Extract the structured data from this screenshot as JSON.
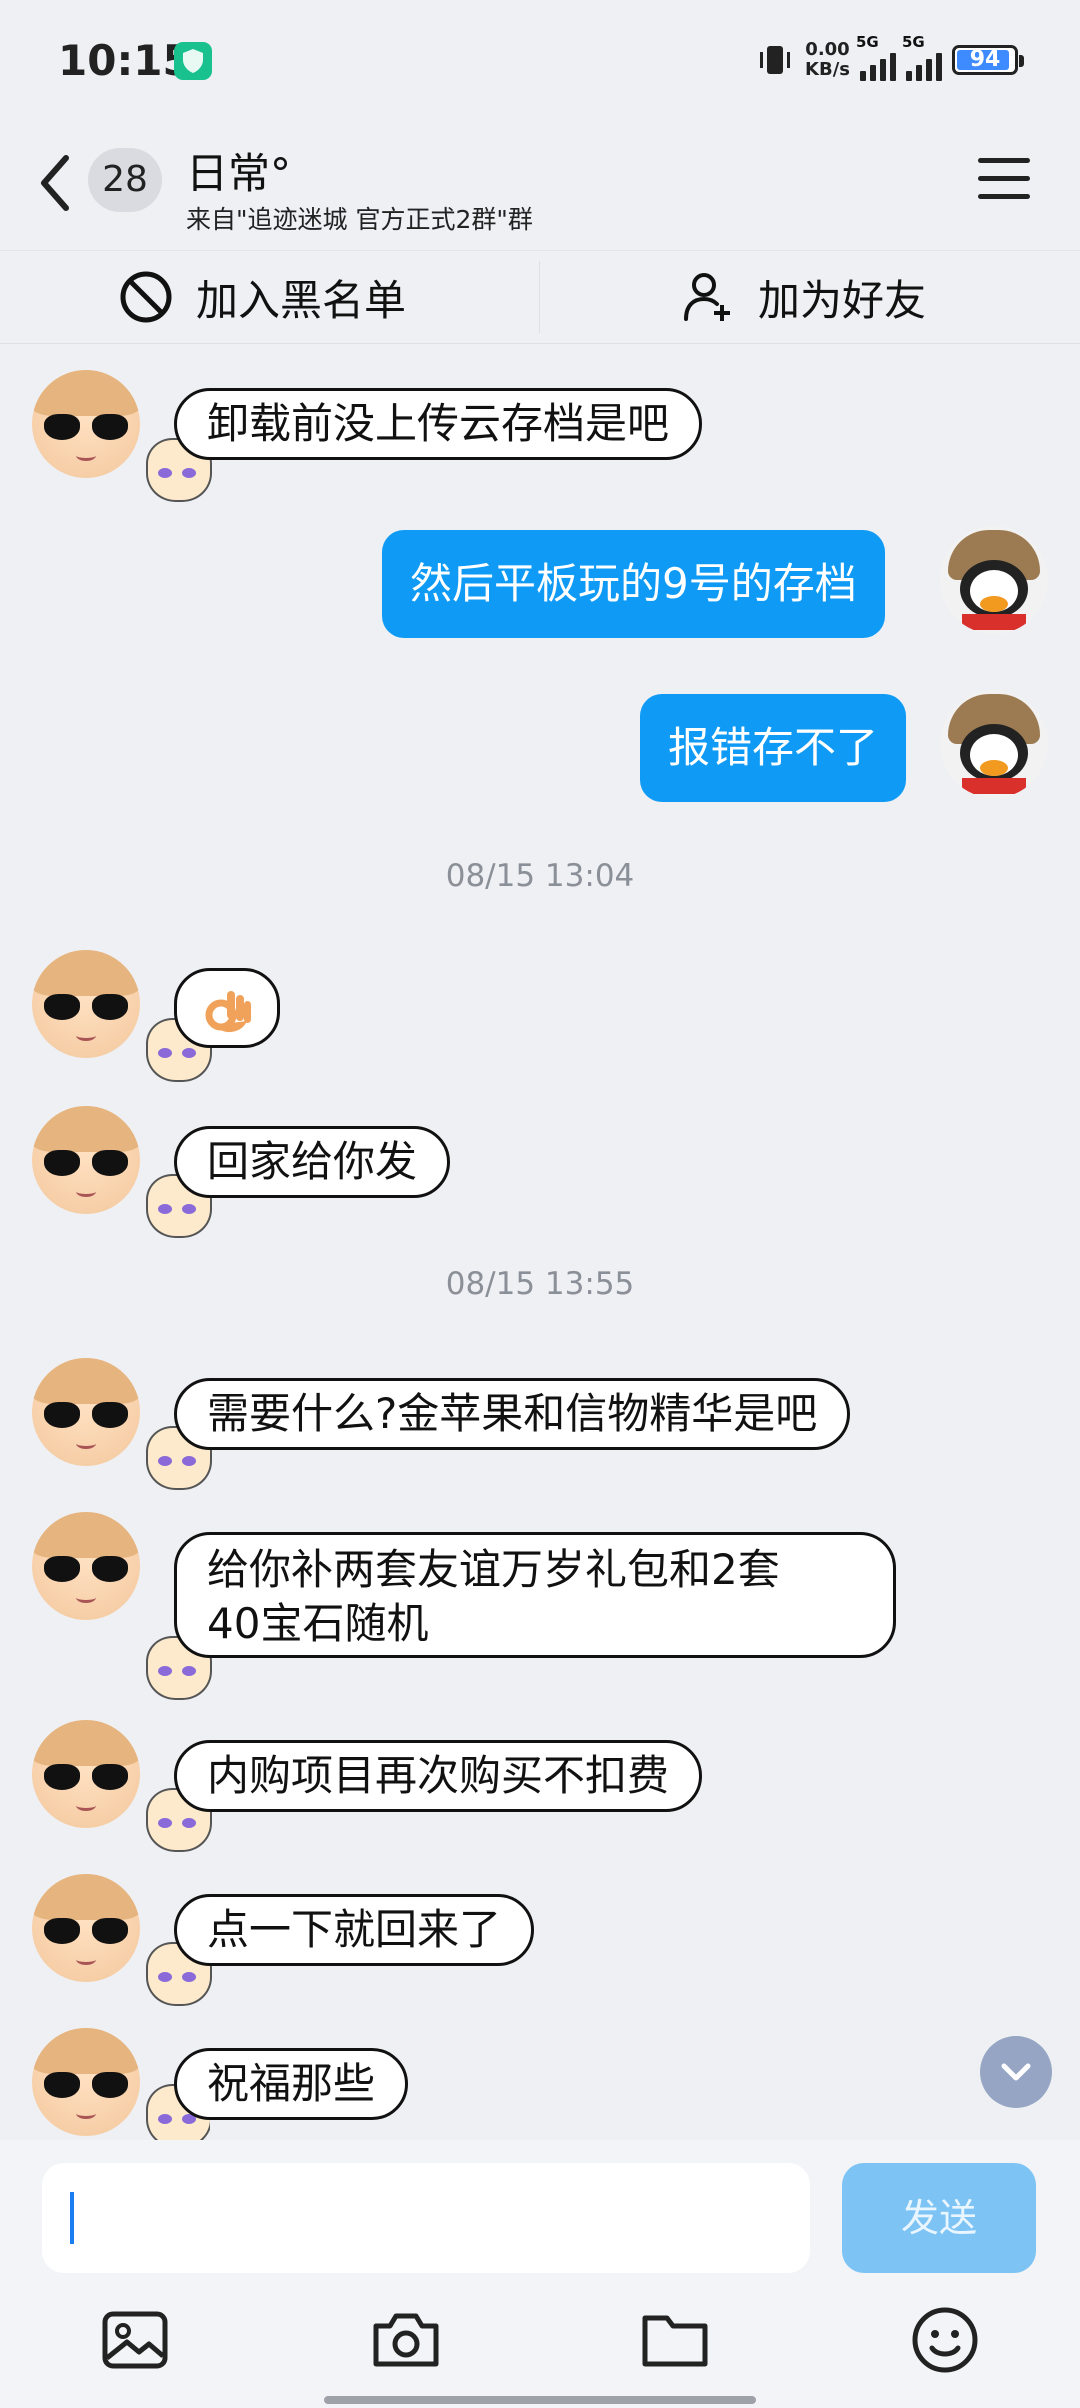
{
  "status_bar": {
    "time": "10:15",
    "net_speed_value": "0.00",
    "net_speed_unit": "KB/s",
    "sim1": "5G",
    "sim2": "5G",
    "battery": "94"
  },
  "header": {
    "unread_count": "28",
    "title": "日常°",
    "subtitle": "来自\"追迹迷城 官方正式2群\"群"
  },
  "actions": {
    "block_label": "加入黑名单",
    "add_friend_label": "加为好友"
  },
  "messages": [
    {
      "side": "left",
      "text": "卸载前没上传云存档是吧"
    },
    {
      "side": "right",
      "text": "然后平板玩的9号的存档"
    },
    {
      "side": "right",
      "text": "报错存不了"
    },
    {
      "type": "timestamp",
      "text": "08/15 13:04"
    },
    {
      "side": "left",
      "text": "👌"
    },
    {
      "side": "left",
      "text": "回家给你发"
    },
    {
      "type": "timestamp",
      "text": "08/15 13:55"
    },
    {
      "side": "left",
      "text": "需要什么?金苹果和信物精华是吧"
    },
    {
      "side": "left",
      "text_line1": "给你补两套友谊万岁礼包和2套",
      "text_line2": "40宝石随机"
    },
    {
      "side": "left",
      "text": "内购项目再次购买不扣费"
    },
    {
      "side": "left",
      "text": "点一下就回来了"
    },
    {
      "side": "left",
      "text": "祝福那些"
    }
  ],
  "composer": {
    "input_value": "",
    "send_label": "发送"
  },
  "toolbar": {
    "icons": [
      "image-icon",
      "camera-icon",
      "folder-icon",
      "emoji-icon"
    ]
  },
  "colors": {
    "outgoing_bubble": "#0f9bf5",
    "send_button": "#7dc4f5",
    "background": "#eef0f4"
  }
}
